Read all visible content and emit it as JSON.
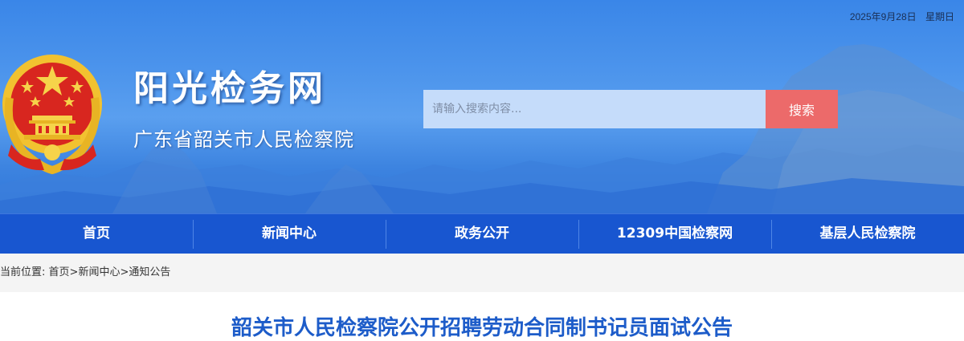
{
  "header": {
    "date": "2025年9月28日",
    "weekday": "星期日",
    "site_title": "阳光检务网",
    "site_subtitle": "广东省韶关市人民检察院"
  },
  "search": {
    "placeholder": "请输入搜索内容...",
    "value": "",
    "button_label": "搜索"
  },
  "nav": {
    "items": [
      {
        "label": "首页"
      },
      {
        "label": "新闻中心"
      },
      {
        "label": "政务公开"
      },
      {
        "label": "12309中国检察网"
      },
      {
        "label": "基层人民检察院"
      }
    ]
  },
  "breadcrumb": {
    "prefix": "当前位置: ",
    "items": [
      "首页",
      "新闻中心",
      "通知公告"
    ],
    "separator": ">"
  },
  "article": {
    "title": "韶关市人民检察院公开招聘劳动合同制书记员面试公告"
  },
  "colors": {
    "banner_blue": "#4d95ec",
    "nav_blue": "#1856d0",
    "search_button": "#ec6a6a",
    "title_blue": "#1d5cc9",
    "emblem_red": "#d8261f",
    "emblem_gold": "#f2c230"
  }
}
